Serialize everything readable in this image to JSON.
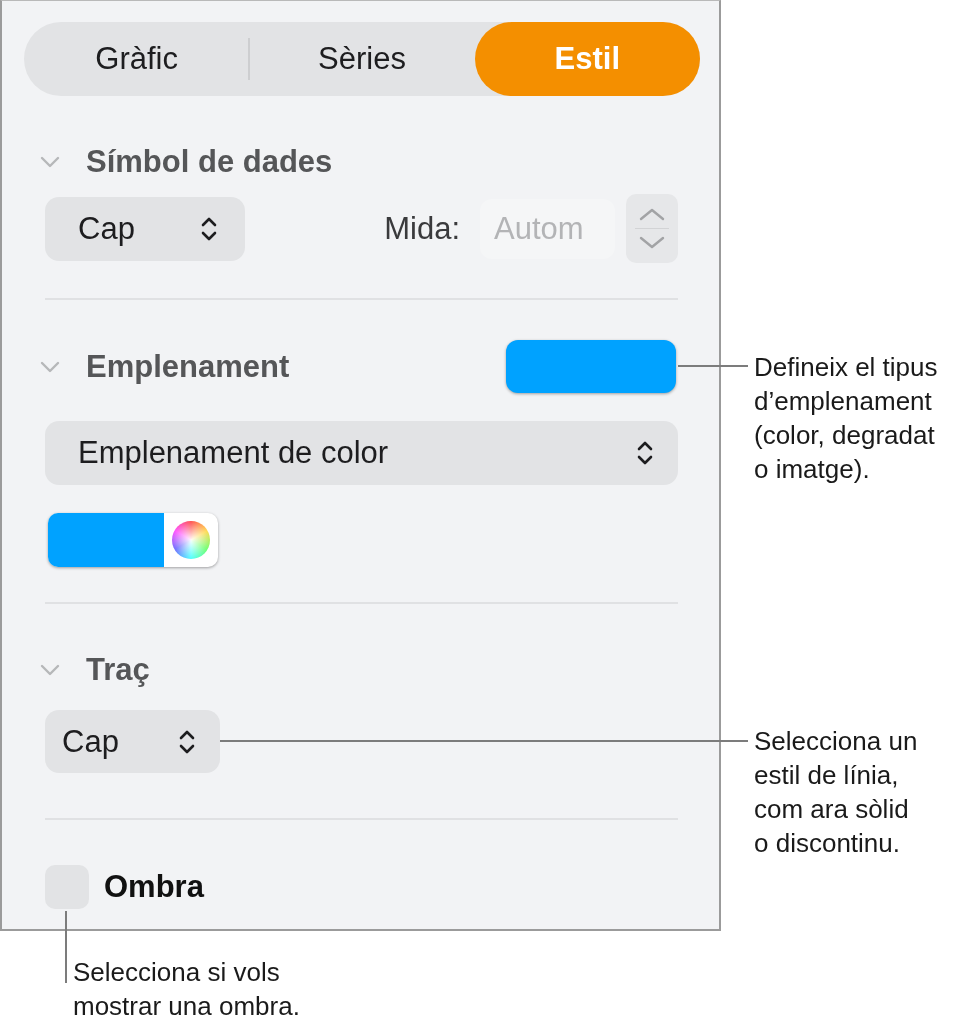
{
  "tabs": [
    {
      "label": "Gràfic",
      "selected": false
    },
    {
      "label": "Sèries",
      "selected": false
    },
    {
      "label": "Estil",
      "selected": true
    }
  ],
  "sections": [
    {
      "kind": "symbol",
      "title": "Símbol de dades",
      "expanded": true,
      "style_popup": "Cap",
      "size_label": "Mida:",
      "size_field": {
        "placeholder": "Autom"
      }
    },
    {
      "kind": "fill",
      "title": "Emplenament",
      "expanded": true,
      "color": "#00a2ff",
      "fill_popup": "Emplenament de color"
    },
    {
      "kind": "stroke",
      "title": "Traç",
      "expanded": true,
      "style_popup": "Cap"
    },
    {
      "kind": "checkbox",
      "label": "Ombra",
      "checked": false
    }
  ],
  "callouts": [
    {
      "text": "Defineix el tipus d’emplenament (color, degradat o imatge)."
    },
    {
      "text": "Selecciona un estil de línia, com ara sòlid o discontinu."
    },
    {
      "text": "Selecciona si vols mostrar una ombra."
    }
  ]
}
